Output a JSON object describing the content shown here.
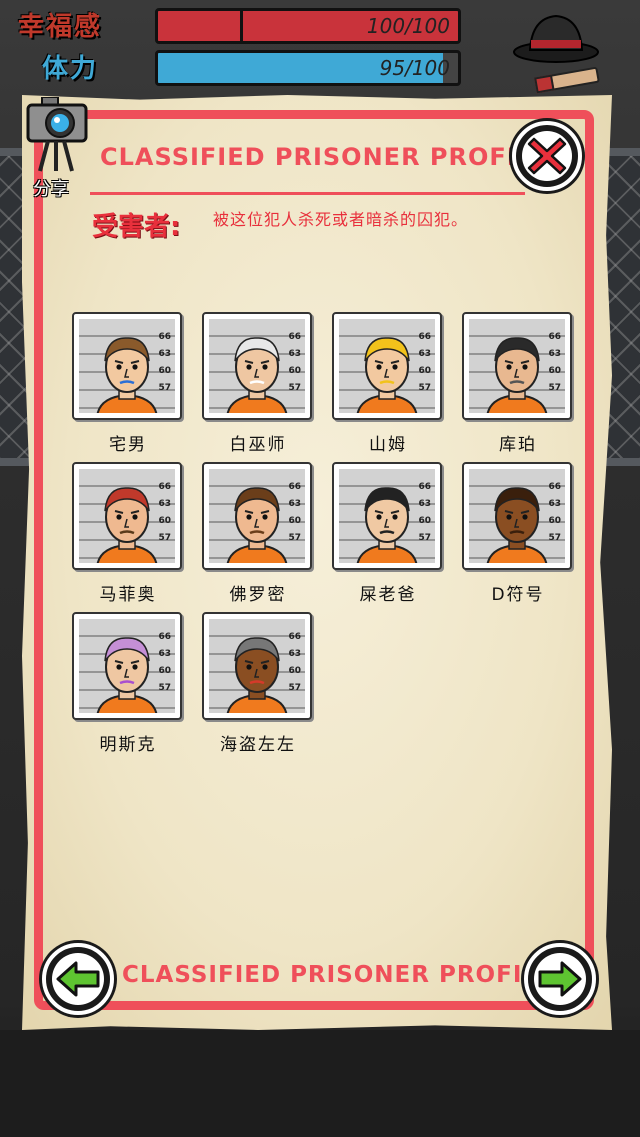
{
  "hud": {
    "happiness_label": "幸福感",
    "happiness_value": "100/100",
    "happiness_fraction": 1.0,
    "stamina_label": "体力",
    "stamina_value": "95/100",
    "stamina_fraction": 0.95
  },
  "panel": {
    "title": "CLASSIFIED PRISONER PROFILE",
    "share_label": "分享",
    "victims_label": "受害者:",
    "victims_description": "被这位犯人杀死或者暗杀的囚犯。",
    "footer_title": "CLASSIFIED PRISONER PROFILE"
  },
  "mugshot_heights": [
    "66",
    "63",
    "60",
    "57"
  ],
  "prisoners": [
    {
      "name": "宅男",
      "skin": "#f2c9a0",
      "hair": "#8a5a2b",
      "accent": "#2b6fd6"
    },
    {
      "name": "白巫师",
      "skin": "#efc7a2",
      "hair": "#e8e8e8",
      "accent": "#ffffff"
    },
    {
      "name": "山姆",
      "skin": "#f2c9a0",
      "hair": "#f2c21b",
      "accent": "#f2c21b"
    },
    {
      "name": "库珀",
      "skin": "#e8b890",
      "hair": "#2a2a2a",
      "accent": "#555555"
    },
    {
      "name": "马菲奥",
      "skin": "#efb990",
      "hair": "#c0392b",
      "accent": "#5a3a1a"
    },
    {
      "name": "佛罗密",
      "skin": "#efb990",
      "hair": "#6b3e1a",
      "accent": "#6b3e1a"
    },
    {
      "name": "屎老爸",
      "skin": "#f0c9a3",
      "hair": "#222222",
      "accent": "#222222"
    },
    {
      "name": "D符号",
      "skin": "#8a4e22",
      "hair": "#3a1f0c",
      "accent": "#3a1f0c"
    },
    {
      "name": "明斯克",
      "skin": "#efc7a2",
      "hair": "#c58fd6",
      "accent": "#a94fcf"
    },
    {
      "name": "海盗左左",
      "skin": "#8a4e22",
      "hair": "#777777",
      "accent": "#d63a2a"
    }
  ],
  "colors": {
    "frame": "#ef4f5a",
    "close_x": "#e8303c",
    "nav_arrow": "#5ec431",
    "happiness_bar": "#c9333b",
    "stamina_bar": "#3fa9d6",
    "jumpsuit": "#f07a1e"
  },
  "icons": [
    "camera-icon",
    "close-icon",
    "arrow-left-icon",
    "arrow-right-icon",
    "fedora-hat-icon",
    "cigar-icon"
  ]
}
